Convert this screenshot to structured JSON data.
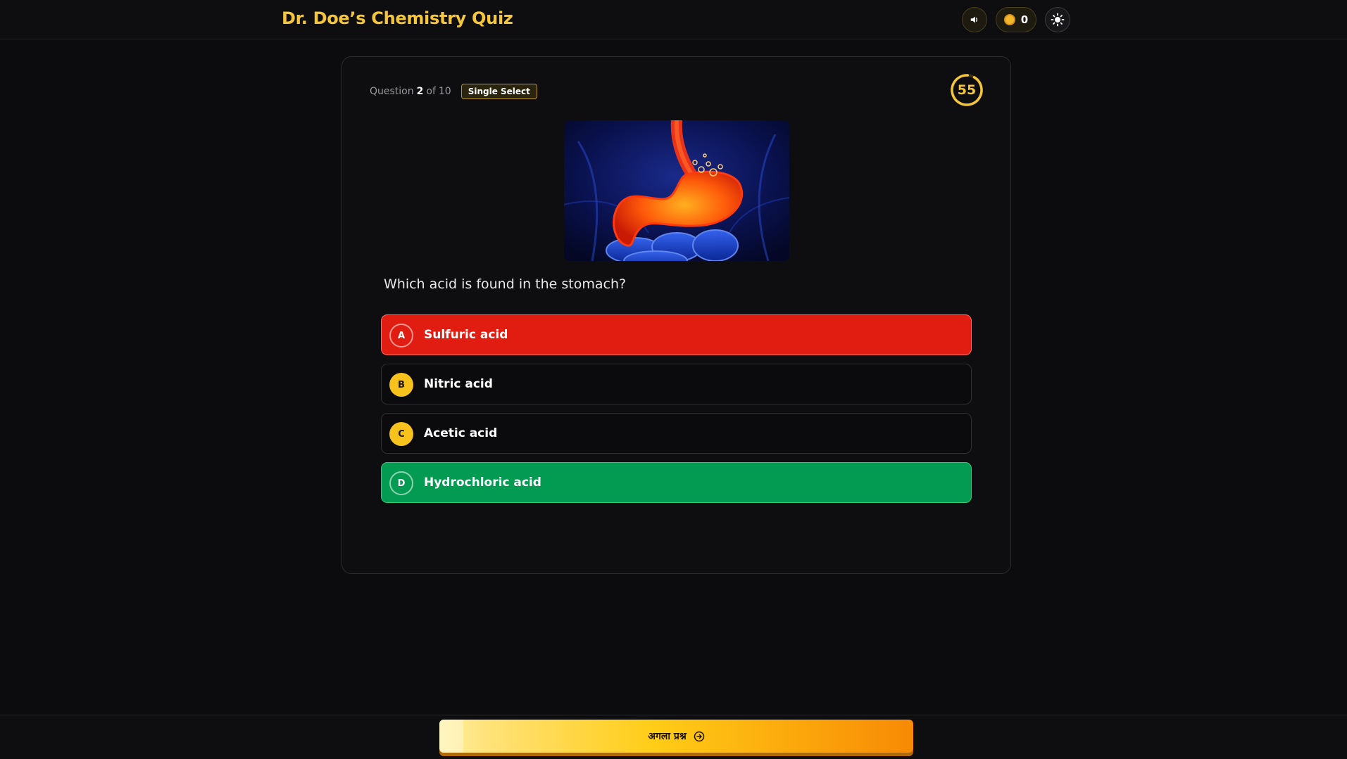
{
  "header": {
    "title": "Dr. Doe’s Chemistry Quiz",
    "sound_icon": "speaker-icon",
    "coins": "0",
    "coin_icon": "coin-icon",
    "theme_icon": "sun-icon"
  },
  "quiz": {
    "question_label": "Question",
    "question_number": "2",
    "of_label": "of",
    "total_questions": "10",
    "question_type": "Single Select",
    "timer": "55",
    "question_text": "Which acid is found in the stomach?",
    "image_description_icon": "stomach-image",
    "options": [
      {
        "letter": "A",
        "label": "Sulfuric acid",
        "state": "wrong"
      },
      {
        "letter": "B",
        "label": "Nitric acid",
        "state": "default"
      },
      {
        "letter": "C",
        "label": "Acetic acid",
        "state": "default"
      },
      {
        "letter": "D",
        "label": "Hydrochloric acid",
        "state": "correct"
      }
    ]
  },
  "footer": {
    "next_label": "अगला प्रश्न",
    "next_icon": "arrow-right-circle-icon"
  },
  "colors": {
    "accent": "#f5c53a",
    "wrong": "#e11d12",
    "correct": "#039b52",
    "background": "#0c0c0e"
  }
}
